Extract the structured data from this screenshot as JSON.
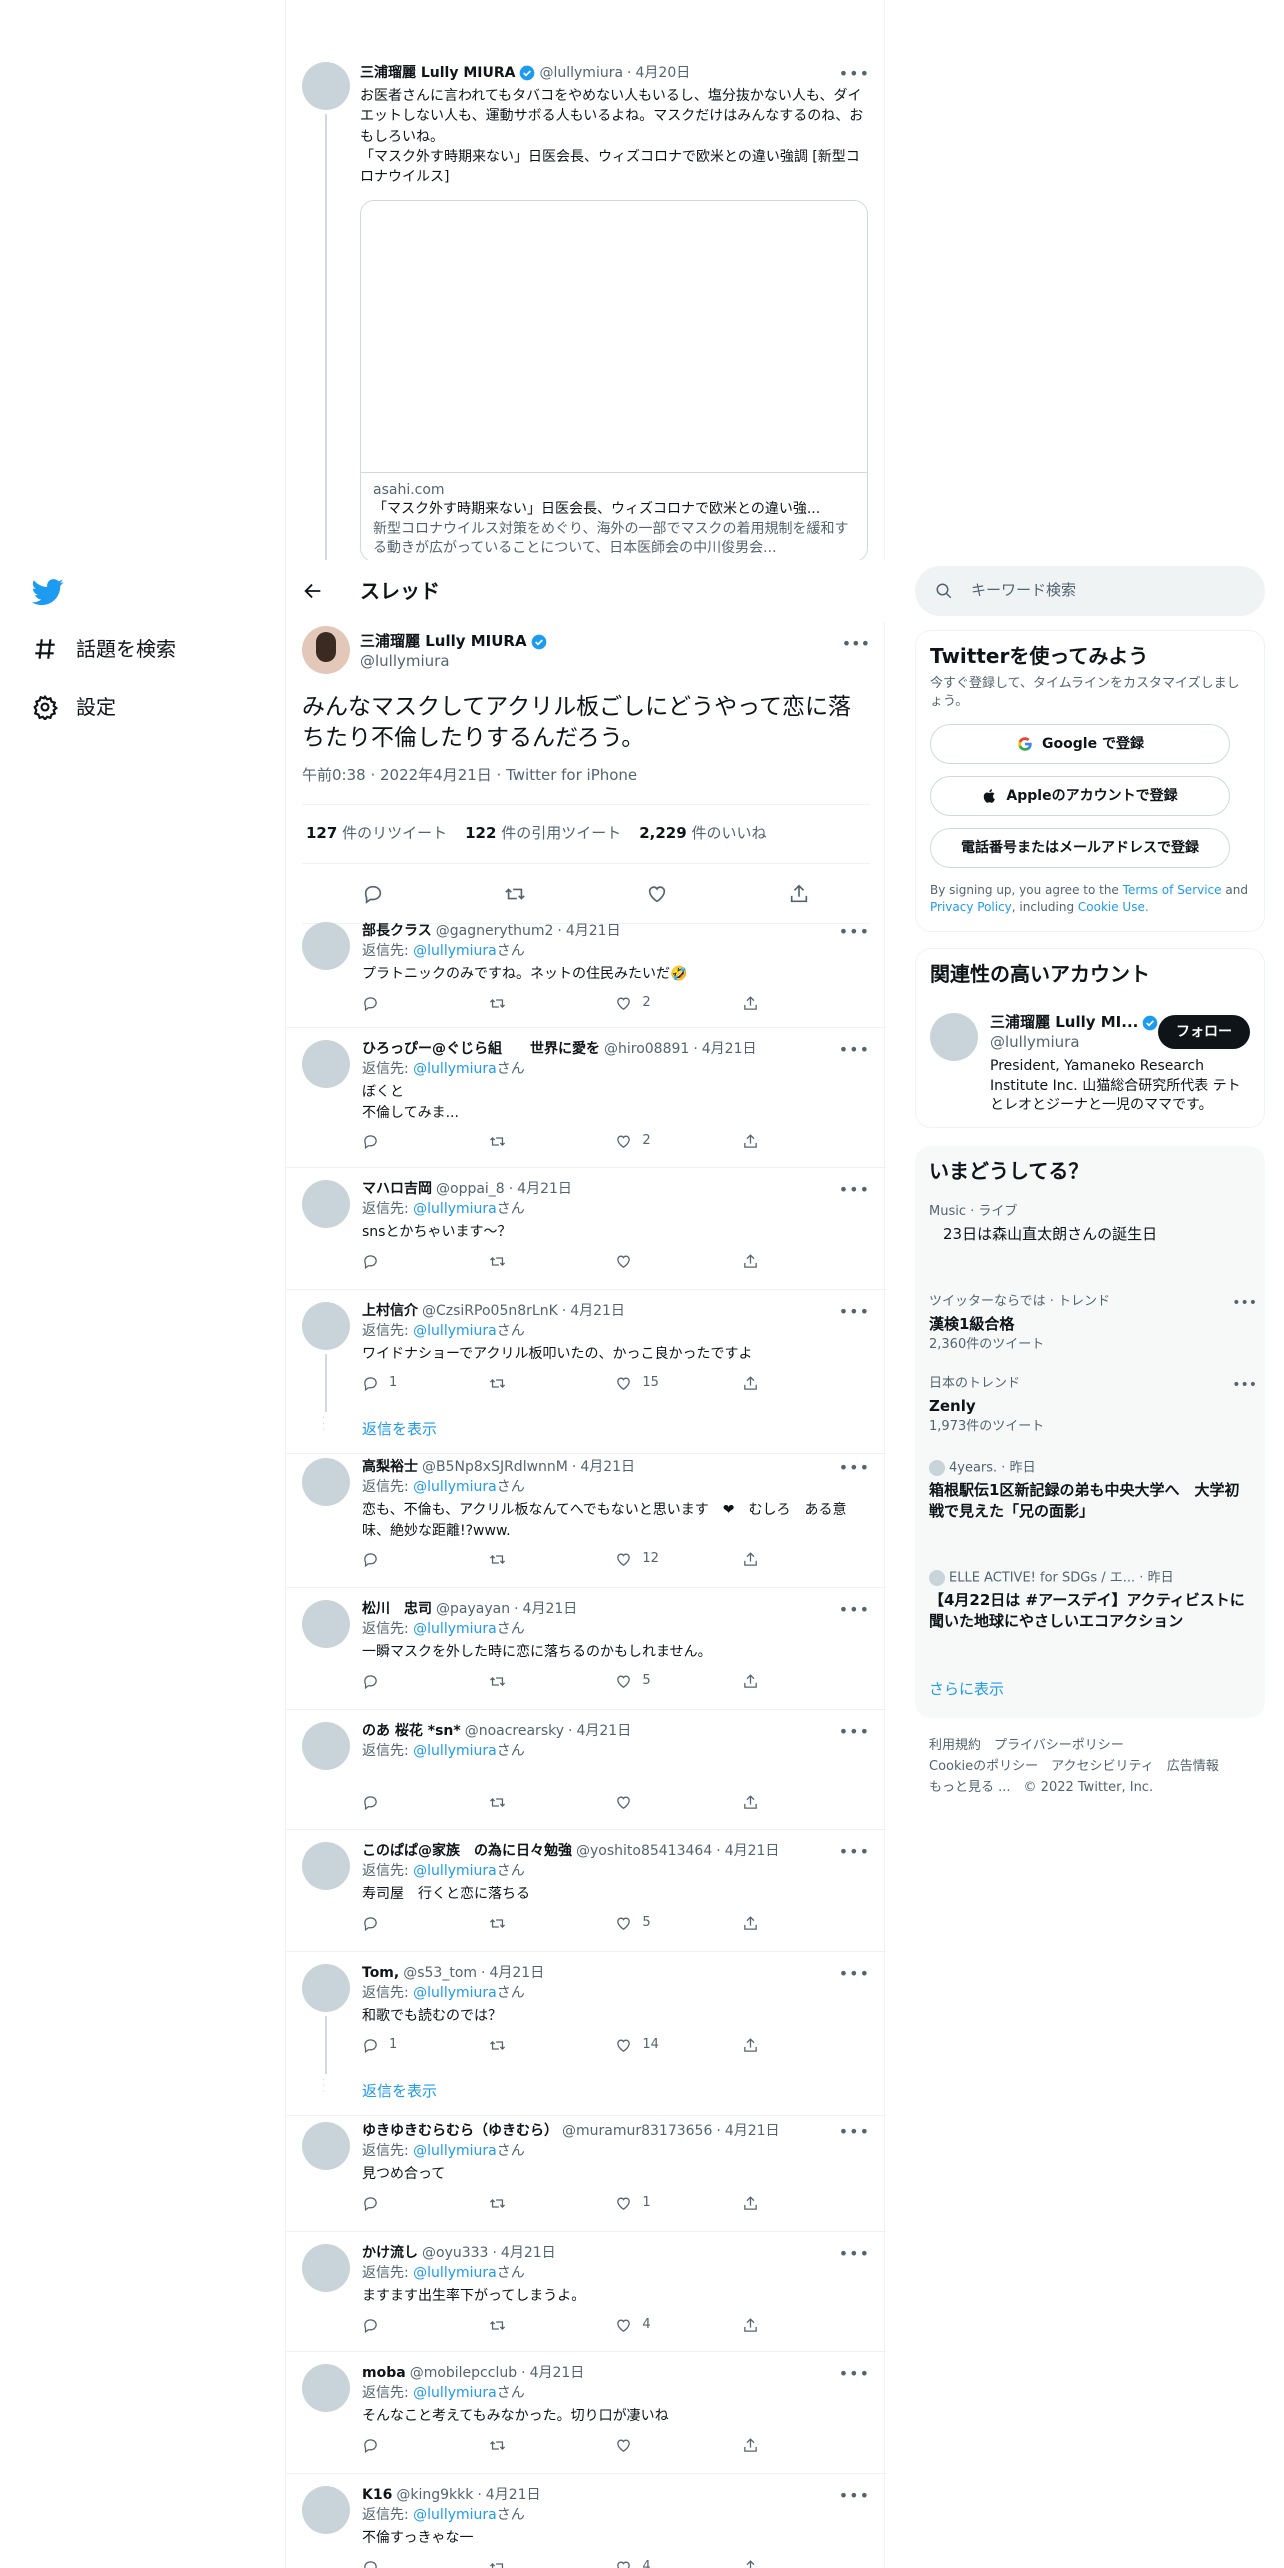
{
  "nav": {
    "explore": "話題を検索",
    "settings": "設定"
  },
  "quoted": {
    "name": "三浦瑠麗 Lully MIURA",
    "handle": "@lullymiura",
    "date": "4月20日",
    "text1": "お医者さんに言われてもタバコをやめない人もいるし、塩分抜かない人も、ダイエットしない人も、運動サボる人もいるよね。マスクだけはみんなするのね、おもしろいね。",
    "text2": "「マスク外す時期来ない」日医会長、ウィズコロナで欧米との違い強調 [新型コロナウイルス]",
    "card_domain": "asahi.com",
    "card_title": "「マスク外す時期来ない」日医会長、ウィズコロナで欧米との違い強...",
    "card_desc": "新型コロナウイルス対策をめぐり、海外の一部でマスクの着用規制を緩和する動きが広がっていることについて、日本医師会の中川俊男会..."
  },
  "thread": {
    "title": "スレッド"
  },
  "main": {
    "name": "三浦瑠麗 Lully MIURA",
    "handle": "@lullymiura",
    "text": "みんなマスクしてアクリル板ごしにどうやって恋に落ちたり不倫したりするんだろう。",
    "time": "午前0:38 · 2022年4月21日 · Twitter for iPhone",
    "retweets": "127",
    "retweets_label": "件のリツイート",
    "quotes": "122",
    "quotes_label": "件の引用ツイート",
    "likes": "2,229",
    "likes_label": "件のいいね"
  },
  "reply_to_prefix": "返信先: ",
  "reply_to_handle": "@lullymiura",
  "reply_to_suffix": "さん",
  "show_replies": "返信を表示",
  "replies": [
    {
      "name": "部長クラス",
      "handle": "@gagnerythum2",
      "date": "4月21日",
      "text": "プラトニックのみですね。ネットの住民みたいだ🤣",
      "replies": "",
      "likes": "2"
    },
    {
      "name": "ひろっぴー@ぐじら組　　世界に愛を",
      "handle": "@hiro08891",
      "date": "4月21日",
      "text": "ぼくと\n不倫してみま...",
      "replies": "",
      "likes": "2"
    },
    {
      "name": "マハロ吉岡",
      "handle": "@oppai_8",
      "date": "4月21日",
      "text": "snsとかちゃいます〜？",
      "replies": "",
      "likes": ""
    },
    {
      "name": "上村信介",
      "handle": "@CzsiRPo05n8rLnK",
      "date": "4月21日",
      "text": "ワイドナショーでアクリル板叩いたの、かっこ良かったですよ",
      "replies": "1",
      "likes": "15"
    },
    {
      "name": "高梨裕士",
      "handle": "@B5Np8xSJRdlwnnM",
      "date": "4月21日",
      "text": "恋も、不倫も、アクリル板なんてへでもないと思います　❤　むしろ　ある意味、絶妙な距離!?www.",
      "replies": "",
      "likes": "12"
    },
    {
      "name": "松川　忠司",
      "handle": "@payayan",
      "date": "4月21日",
      "text": "一瞬マスクを外した時に恋に落ちるのかもしれません。",
      "replies": "",
      "likes": "5"
    },
    {
      "name": "のあ 桜花 *sn*",
      "handle": "@noacrearsky",
      "date": "4月21日",
      "text": "",
      "replies": "",
      "likes": ""
    },
    {
      "name": "このぱぱ@家族　の為に日々勉強",
      "handle": "@yoshito85413464",
      "date": "4月21日",
      "text": "寿司屋　行くと恋に落ちる",
      "replies": "",
      "likes": "5"
    },
    {
      "name": "Tom,",
      "handle": "@s53_tom",
      "date": "4月21日",
      "text": "和歌でも読むのでは？",
      "replies": "1",
      "likes": "14"
    },
    {
      "name": "ゆきゆきむらむら（ゆきむら）",
      "handle": "@muramur83173656",
      "date": "4月21日",
      "text": "見つめ合って",
      "replies": "",
      "likes": "1"
    },
    {
      "name": "かけ流し",
      "handle": "@oyu333",
      "date": "4月21日",
      "text": "ますます出生率下がってしまうよ。",
      "replies": "",
      "likes": "4"
    },
    {
      "name": "moba",
      "handle": "@mobilepcclub",
      "date": "4月21日",
      "text": "そんなこと考えてもみなかった。切り口が凄いね",
      "replies": "",
      "likes": ""
    },
    {
      "name": "K16",
      "handle": "@king9kkk",
      "date": "4月21日",
      "text": "不倫すっきゃな一",
      "replies": "",
      "likes": "4"
    }
  ],
  "search": {
    "placeholder": "キーワード検索"
  },
  "signup": {
    "title": "Twitterを使ってみよう",
    "subtitle": "今すぐ登録して、タイムラインをカスタマイズしましょう。",
    "google": "Google で登録",
    "apple": "Appleのアカウントで登録",
    "phone": "電話番号またはメールアドレスで登録",
    "legal1": "By signing up, you agree to the",
    "tos": "Terms of Service",
    "and": "and",
    "privacy": "Privacy Policy",
    "including": ", including",
    "cookie": "Cookie Use."
  },
  "related": {
    "title": "関連性の高いアカウント",
    "name": "三浦瑠麗 Lully MI...",
    "handle": "@lullymiura",
    "follow": "フォロー",
    "bio": "President, Yamaneko Research Institute Inc. 山猫総合研究所代表 テトとレオとジーナと一児のママです。"
  },
  "trends": {
    "title": "いまどうしてる？",
    "items": [
      {
        "cat": "Music · ライブ",
        "title": "23日は森山直太朗さんの誕生日",
        "count": ""
      },
      {
        "cat": "ツイッターならでは · トレンド",
        "title": "漢検1級合格",
        "count": "2,360件のツイート"
      },
      {
        "cat": "日本のトレンド",
        "title": "Zenly",
        "count": "1,973件のツイート"
      },
      {
        "cat": "4years. · 昨日",
        "title": "箱根駅伝1区新記録の弟も中央大学へ　大学初戦で見えた「兄の面影」",
        "count": ""
      },
      {
        "cat": "ELLE ACTIVE! for SDGs / エ... · 昨日",
        "title": "【4月22日は #アースデイ】アクティビストに聞いた地球にやさしいエコアクション",
        "count": ""
      }
    ],
    "show_more": "さらに表示"
  },
  "footer": {
    "terms": "利用規約",
    "privacy": "プライバシーポリシー",
    "cookie": "Cookieのポリシー",
    "access": "アクセシビリティ",
    "ads": "広告情報",
    "more": "もっと見る ...",
    "copy": "© 2022 Twitter, Inc."
  },
  "colors": {
    "accent": "#1d9bf0",
    "text": "#0f1419",
    "muted": "#536471",
    "border": "#eff3f4"
  }
}
